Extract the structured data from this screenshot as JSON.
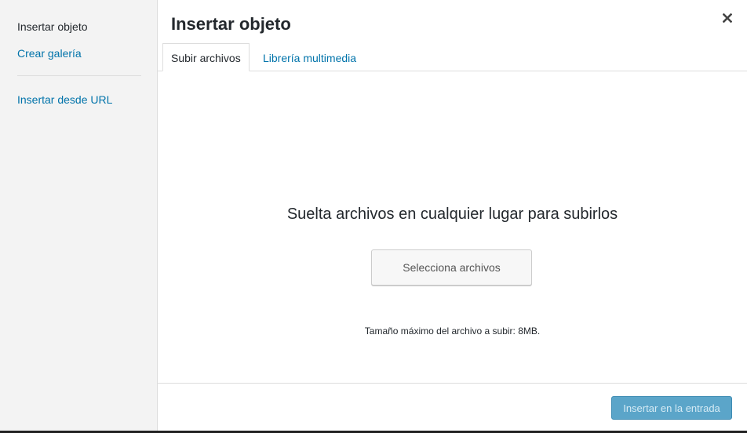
{
  "sidebar": {
    "items": [
      {
        "label": "Insertar objeto"
      },
      {
        "label": "Crear galería"
      },
      {
        "label": "Insertar desde URL"
      }
    ]
  },
  "header": {
    "title": "Insertar objeto",
    "close_icon": "close-icon",
    "close_glyph": "×"
  },
  "tabs": [
    {
      "label": "Subir archivos",
      "active": true
    },
    {
      "label": "Librería multimedia",
      "active": false
    }
  ],
  "upload": {
    "drop_text": "Suelta archivos en cualquier lugar para subirlos",
    "select_label": "Selecciona archivos",
    "max_size_text": "Tamaño máximo del archivo a subir: 8MB."
  },
  "toolbar": {
    "insert_label": "Insertar en la entrada",
    "insert_disabled": true
  },
  "colors": {
    "link": "#0073aa",
    "text": "#23282d",
    "sidebar_bg": "#f3f3f3",
    "primary_button_disabled": "#5ba5c9"
  }
}
